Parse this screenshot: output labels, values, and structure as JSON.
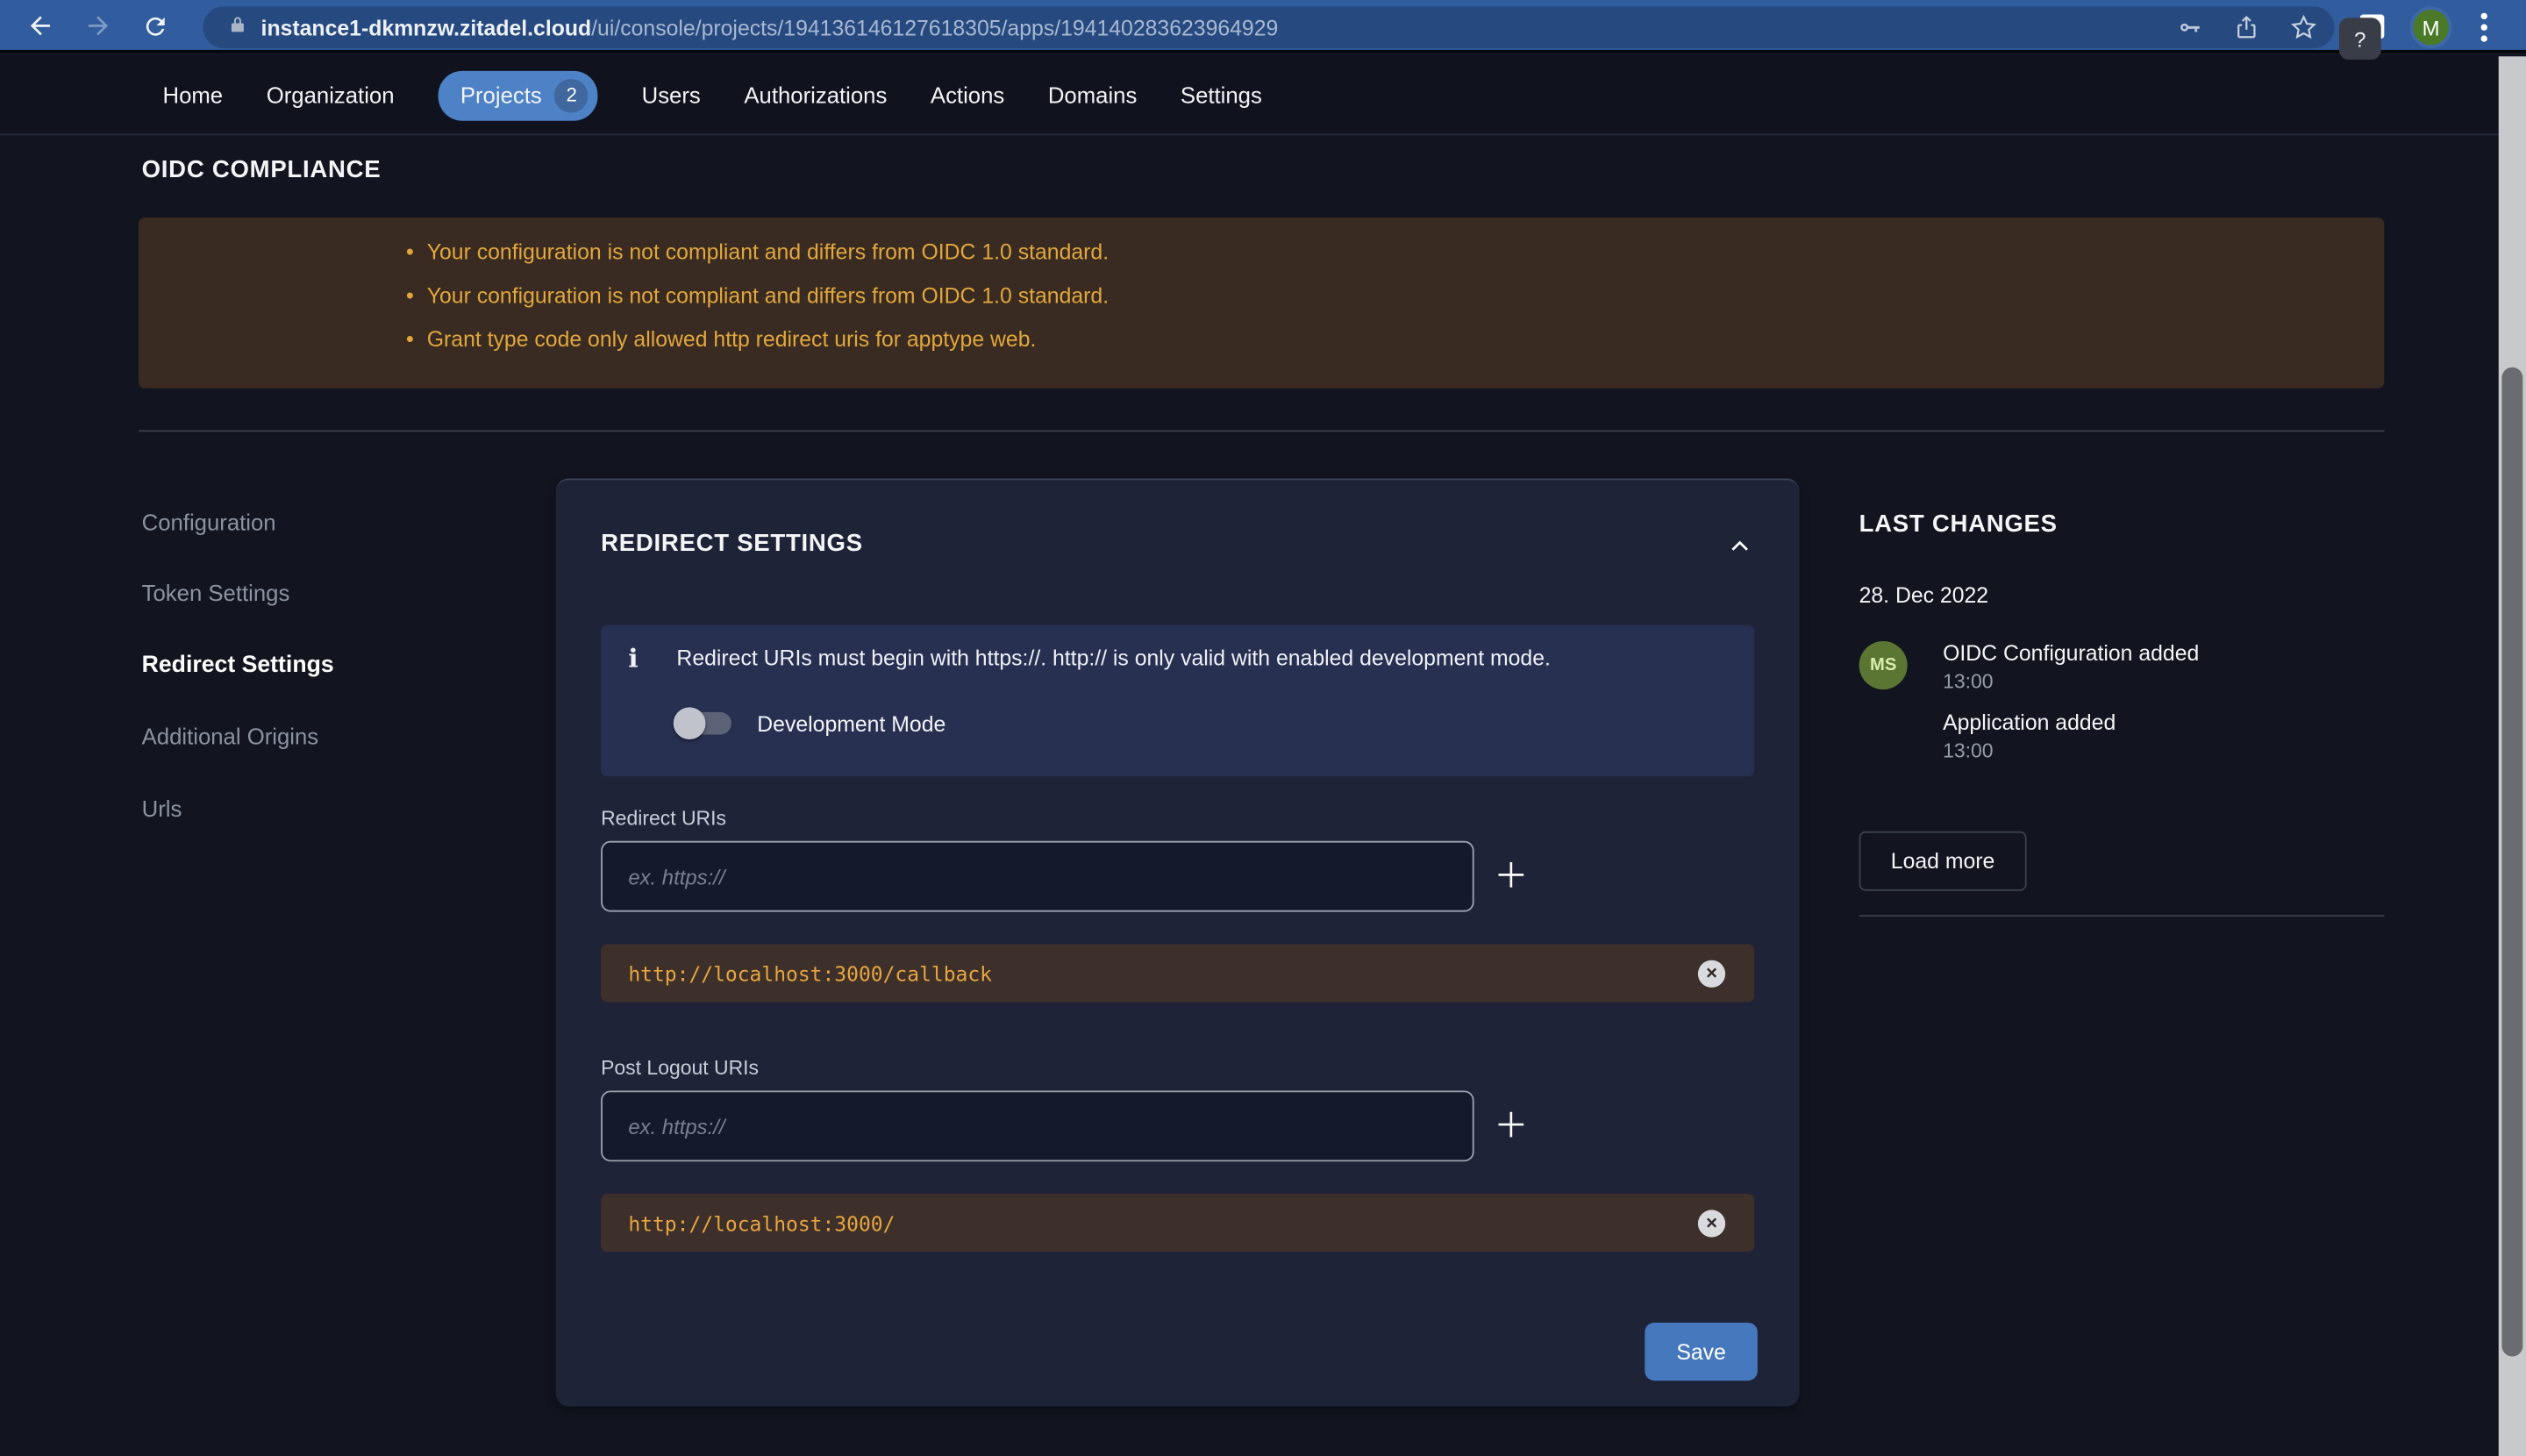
{
  "browser": {
    "url_domain": "instance1-dkmnzw.zitadel.cloud",
    "url_path": "/ui/console/projects/194136146127618305/apps/194140283623964929",
    "avatar_initial": "M"
  },
  "nav": {
    "items": [
      "Home",
      "Organization",
      "Projects",
      "Users",
      "Authorizations",
      "Actions",
      "Domains",
      "Settings"
    ],
    "projects_badge": "2",
    "help_label": "?"
  },
  "compliance": {
    "title": "OIDC COMPLIANCE",
    "warnings": [
      "Your configuration is not compliant and differs from OIDC 1.0 standard.",
      "Your configuration is not compliant and differs from OIDC 1.0 standard.",
      "Grant type code only allowed http redirect uris for apptype web."
    ]
  },
  "sidebar": {
    "items": [
      {
        "label": "Configuration",
        "active": false
      },
      {
        "label": "Token Settings",
        "active": false
      },
      {
        "label": "Redirect Settings",
        "active": true
      },
      {
        "label": "Additional Origins",
        "active": false
      },
      {
        "label": "Urls",
        "active": false
      }
    ]
  },
  "redirect_settings": {
    "title": "REDIRECT SETTINGS",
    "info_text": "Redirect URIs must begin with https://. http:// is only valid with enabled development mode.",
    "dev_mode": {
      "label": "Development Mode",
      "enabled": false
    },
    "redirect_uris": {
      "label": "Redirect URIs",
      "placeholder": "ex. https://",
      "values": [
        "http://localhost:3000/callback"
      ]
    },
    "post_logout_uris": {
      "label": "Post Logout URIs",
      "placeholder": "ex. https://",
      "values": [
        "http://localhost:3000/"
      ]
    },
    "save_label": "Save"
  },
  "last_changes": {
    "title": "LAST CHANGES",
    "date": "28. Dec 2022",
    "avatar_initials": "MS",
    "entries": [
      {
        "label": "OIDC Configuration added",
        "time": "13:00"
      },
      {
        "label": "Application added",
        "time": "13:00"
      }
    ],
    "load_more_label": "Load more"
  },
  "icons": {
    "bullet": "•",
    "close": "×",
    "info": "i"
  },
  "colors": {
    "accent_blue": "#4678bd",
    "nav_pill_blue": "#4d82c6",
    "warning_amber": "#e2a73d",
    "warning_bg": "#392b21",
    "chip_bg": "#3d2f2a",
    "avatar_green": "#5b7532"
  }
}
